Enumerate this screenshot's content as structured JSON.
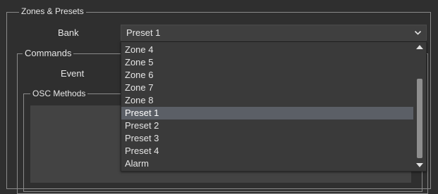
{
  "zones_presets": {
    "legend": "Zones & Presets",
    "bank_label": "Bank",
    "bank_selected": "Preset 1"
  },
  "commands": {
    "legend": "Commands",
    "event_label": "Event"
  },
  "osc_methods": {
    "legend": "OSC Methods"
  },
  "dropdown": {
    "options": [
      "Zone 4",
      "Zone 5",
      "Zone 6",
      "Zone 7",
      "Zone 8",
      "Preset 1",
      "Preset 2",
      "Preset 3",
      "Preset 4",
      "Alarm"
    ],
    "selected_index": 5
  },
  "icons": {
    "combo_arrow": "chevron-down-icon",
    "scroll_up": "scroll-up-arrow-icon",
    "scroll_down": "scroll-down-arrow-icon"
  },
  "colors": {
    "background": "#2f2f2f",
    "selection": "#5b5f66",
    "frame": "#8a8a8a"
  }
}
